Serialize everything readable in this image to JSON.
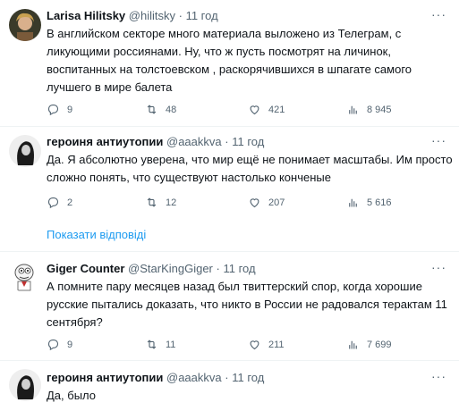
{
  "tweets": [
    {
      "name": "Larisa Hilitsky",
      "handle": "@hilitsky",
      "dot": "·",
      "time": "11 год",
      "text": "В английском секторе много материала выложено из Телеграм, с ликующими россиянами. Ну, что ж пусть посмотрят на личинок, воспитанных на толстоевском , раскорячившихся в шпагате самого лучшего в мире балета",
      "replies": "9",
      "retweets": "48",
      "likes": "421",
      "views": "8 945"
    },
    {
      "name": "героиня антиутопии",
      "handle": "@aaakkva",
      "dot": "·",
      "time": "11 год",
      "text": "Да. Я абсолютно уверена, что мир ещё не понимает масштабы. Им просто сложно понять, что существуют настолько конченые",
      "replies": "2",
      "retweets": "12",
      "likes": "207",
      "views": "5 616"
    },
    {
      "name": "Giger Counter",
      "handle": "@StarKingGiger",
      "dot": "·",
      "time": "11 год",
      "text": "А помните пару месяцев назад был твиттерский спор, когда хорошие русские пытались доказать, что никто в России не радовался терактам 11 сентября?",
      "replies": "9",
      "retweets": "11",
      "likes": "211",
      "views": "7 699"
    },
    {
      "name": "героиня антиутопии",
      "handle": "@aaakkva",
      "dot": "·",
      "time": "11 год",
      "text": "Да, было"
    }
  ],
  "show_replies": "Показати відповіді",
  "more_glyph": "···",
  "colors": {
    "text": "#0f1419",
    "muted": "#536471",
    "link": "#1d9bf0",
    "divider": "#eff3f4",
    "thread_line": "#cfd9de"
  },
  "icons": [
    "reply-icon",
    "retweet-icon",
    "like-icon",
    "views-icon"
  ]
}
